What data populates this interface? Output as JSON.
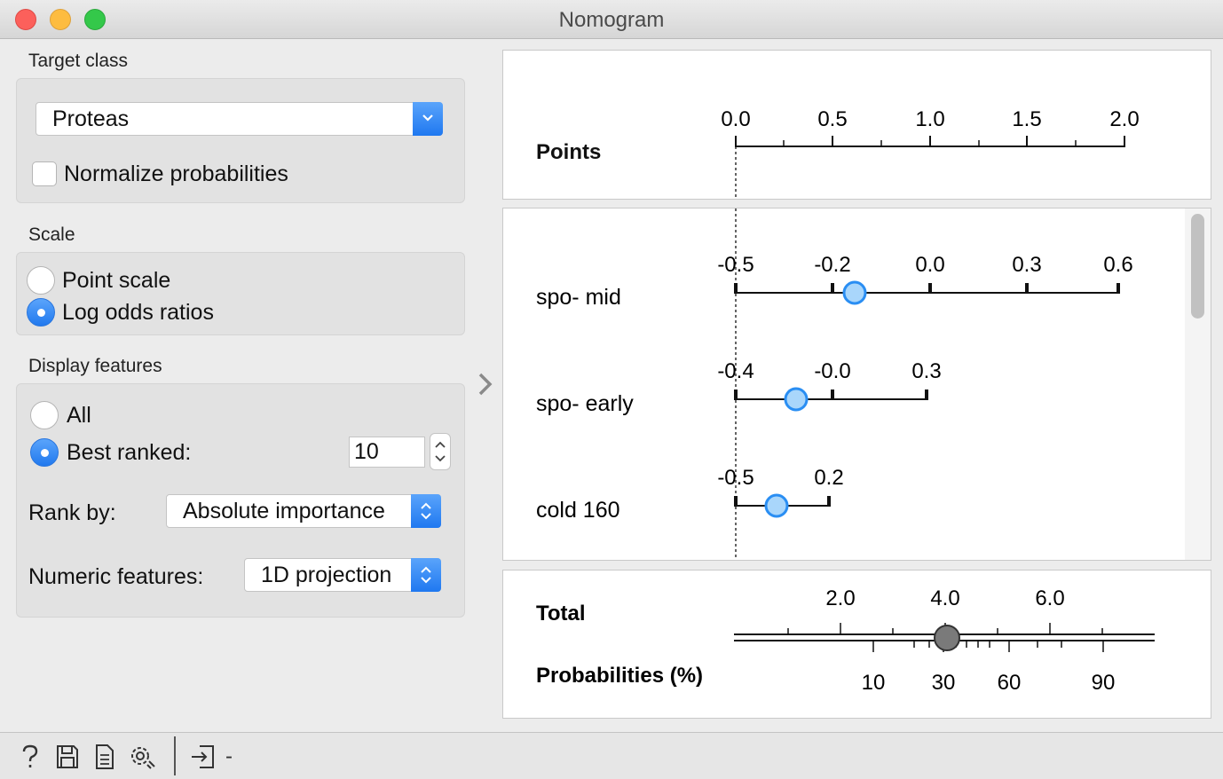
{
  "window": {
    "title": "Nomogram"
  },
  "left": {
    "target_class": {
      "label": "Target class",
      "selected": "Proteas",
      "normalize_label": "Normalize probabilities",
      "normalize_checked": false
    },
    "scale": {
      "label": "Scale",
      "options": [
        "Point scale",
        "Log odds ratios"
      ],
      "selected": "Log odds ratios"
    },
    "display": {
      "label": "Display features",
      "all_label": "All",
      "best_label": "Best ranked:",
      "best_value": "10",
      "selected": "Best ranked:",
      "rank_by_label": "Rank by:",
      "rank_by_value": "Absolute importance",
      "numeric_label": "Numeric features:",
      "numeric_value": "1D projection"
    }
  },
  "nomogram": {
    "points": {
      "label": "Points",
      "ticks": [
        "0.0",
        "0.5",
        "1.0",
        "1.5",
        "2.0"
      ]
    },
    "features": [
      {
        "name": "spo- mid",
        "ticks": [
          "-0.5",
          "-0.2",
          "0.0",
          "0.3",
          "0.6"
        ]
      },
      {
        "name": "spo- early",
        "ticks": [
          "-0.4",
          "-0.0",
          "0.3"
        ]
      },
      {
        "name": "cold 160",
        "ticks": [
          "-0.5",
          "0.2"
        ]
      }
    ],
    "total": {
      "label": "Total",
      "ticks": [
        "2.0",
        "4.0",
        "6.0"
      ],
      "prob_label": "Probabilities (%)",
      "prob_ticks": [
        "10",
        "30",
        "60",
        "90"
      ]
    }
  },
  "status": {
    "output_text": "-"
  },
  "colors": {
    "accent": "#1f78f0",
    "marker": "#a9d6fb",
    "marker_stroke": "#2a8ef3",
    "total_marker": "#7a7a7a"
  },
  "icons": [
    "help-icon",
    "save-icon",
    "report-icon",
    "settings-icon",
    "output-icon"
  ]
}
